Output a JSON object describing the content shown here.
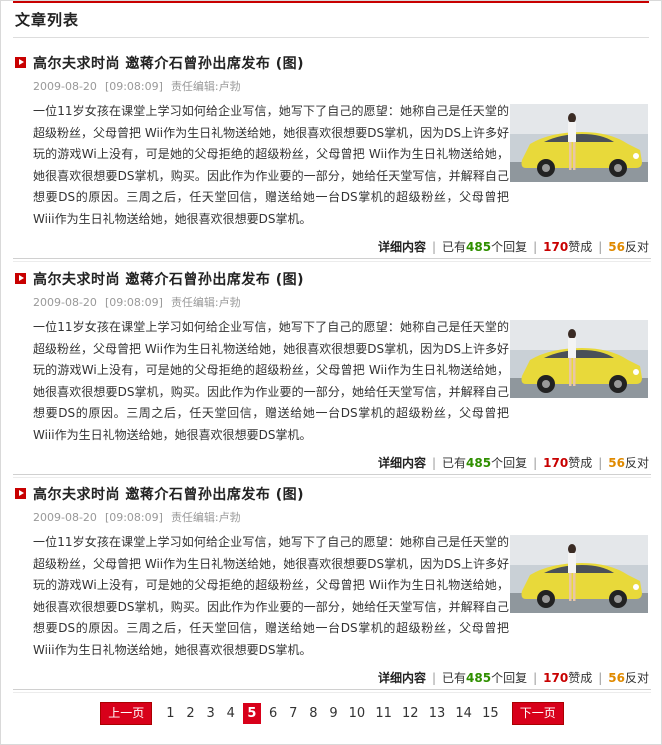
{
  "section": {
    "title": "文章列表"
  },
  "articles": [
    {
      "title": "高尔夫求时尚  邀蒋介石曾孙出席发布 (图)",
      "date": "2009-08-20",
      "time": "[09:08:09]",
      "editor": "责任编辑:卢勃",
      "body": "一位11岁女孩在课堂上学习如何给企业写信，她写下了自己的愿望：她称自己是任天堂的超级粉丝，父母曾把 Wii作为生日礼物送给她，她很喜欢很想要DS掌机，因为DS上许多好玩的游戏Wi上没有，可是她的父母拒绝的超级粉丝，父母曾把 Wii作为生日礼物送给她，她很喜欢很想要DS掌机，购买。因此作为作业要的一部分，她给任天堂写信，并解释自己想要DS的原因。三周之后，任天堂回信，赠送给她一台DS掌机的超级粉丝，父母曾把 Wiii作为生日礼物送给她，她很喜欢很想要DS掌机。",
      "detail": "详细内容",
      "replies_pre": "已有",
      "replies": "485",
      "replies_post": "个回复",
      "likes": "170",
      "likes_label": "赞成",
      "dislikes": "56",
      "dislikes_label": "反对"
    },
    {
      "title": "高尔夫求时尚  邀蒋介石曾孙出席发布 (图)",
      "date": "2009-08-20",
      "time": "[09:08:09]",
      "editor": "责任编辑:卢勃",
      "body": "一位11岁女孩在课堂上学习如何给企业写信，她写下了自己的愿望：她称自己是任天堂的超级粉丝，父母曾把 Wii作为生日礼物送给她，她很喜欢很想要DS掌机，因为DS上许多好玩的游戏Wi上没有，可是她的父母拒绝的超级粉丝，父母曾把 Wii作为生日礼物送给她，她很喜欢很想要DS掌机，购买。因此作为作业要的一部分，她给任天堂写信，并解释自己想要DS的原因。三周之后，任天堂回信，赠送给她一台DS掌机的超级粉丝，父母曾把 Wiii作为生日礼物送给她，她很喜欢很想要DS掌机。",
      "detail": "详细内容",
      "replies_pre": "已有",
      "replies": "485",
      "replies_post": "个回复",
      "likes": "170",
      "likes_label": "赞成",
      "dislikes": "56",
      "dislikes_label": "反对"
    },
    {
      "title": "高尔夫求时尚  邀蒋介石曾孙出席发布 (图)",
      "date": "2009-08-20",
      "time": "[09:08:09]",
      "editor": "责任编辑:卢勃",
      "body": "一位11岁女孩在课堂上学习如何给企业写信，她写下了自己的愿望：她称自己是任天堂的超级粉丝，父母曾把 Wii作为生日礼物送给她，她很喜欢很想要DS掌机，因为DS上许多好玩的游戏Wi上没有，可是她的父母拒绝的超级粉丝，父母曾把 Wii作为生日礼物送给她，她很喜欢很想要DS掌机，购买。因此作为作业要的一部分，她给任天堂写信，并解释自己想要DS的原因。三周之后，任天堂回信，赠送给她一台DS掌机的超级粉丝，父母曾把 Wiii作为生日礼物送给她，她很喜欢很想要DS掌机。",
      "detail": "详细内容",
      "replies_pre": "已有",
      "replies": "485",
      "replies_post": "个回复",
      "likes": "170",
      "likes_label": "赞成",
      "dislikes": "56",
      "dislikes_label": "反对"
    }
  ],
  "pager": {
    "prev": "上一页",
    "next": "下一页",
    "pages": [
      "1",
      "2",
      "3",
      "4",
      "5",
      "6",
      "7",
      "8",
      "9",
      "10",
      "11",
      "12",
      "13",
      "14",
      "15"
    ],
    "current": "5"
  },
  "colors": {
    "accent": "#c80000",
    "green": "#2f8f00",
    "orange": "#e08a00"
  },
  "icons": {
    "title_marker": "play-square-icon",
    "thumb": "yellow-car-photo"
  }
}
